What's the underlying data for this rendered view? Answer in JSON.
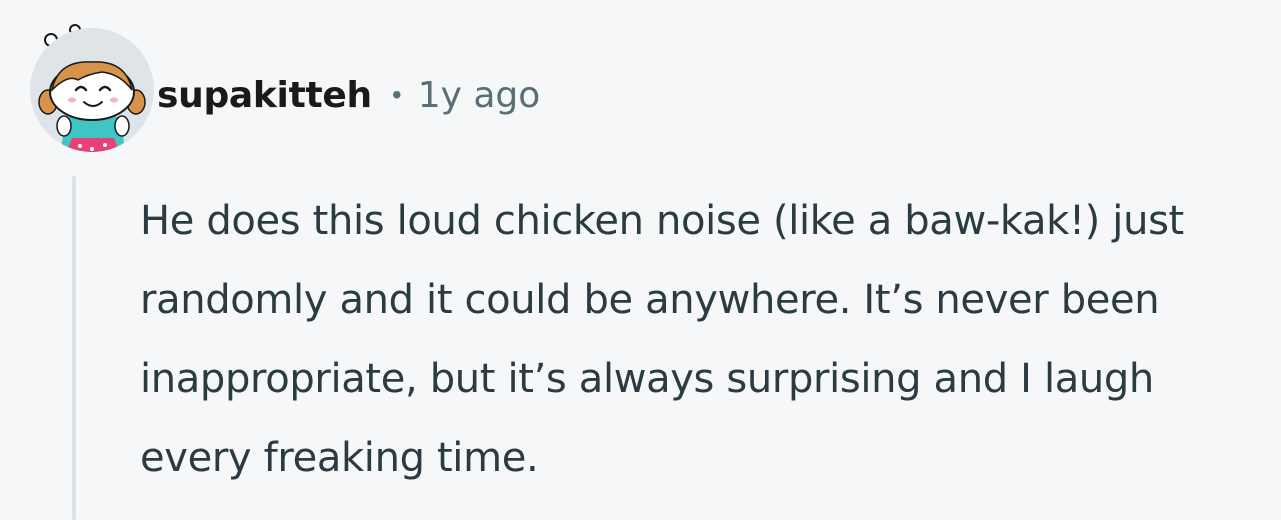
{
  "comment": {
    "author": "supakitteh",
    "separator": "•",
    "timestamp": "1y ago",
    "body": "He does this loud chicken noise (like a baw-kak!) just randomly and it could be anywhere. It’s never been inappropriate, but it’s always surprising and I laugh every freaking time."
  },
  "avatar": {
    "icon": "snoo-avatar-girl-with-pigtails",
    "colors": {
      "background": "#dfe4e8",
      "skin": "#ffffff",
      "hair": "#d9924a",
      "shirt": "#3fc6c4",
      "skirt": "#e8417a"
    }
  },
  "colors": {
    "page_background": "#f6f7f8",
    "username": "#1a1a1b",
    "meta": "#576f76",
    "body_text": "#2a3c42",
    "thread_line": "#dbe2e6"
  }
}
